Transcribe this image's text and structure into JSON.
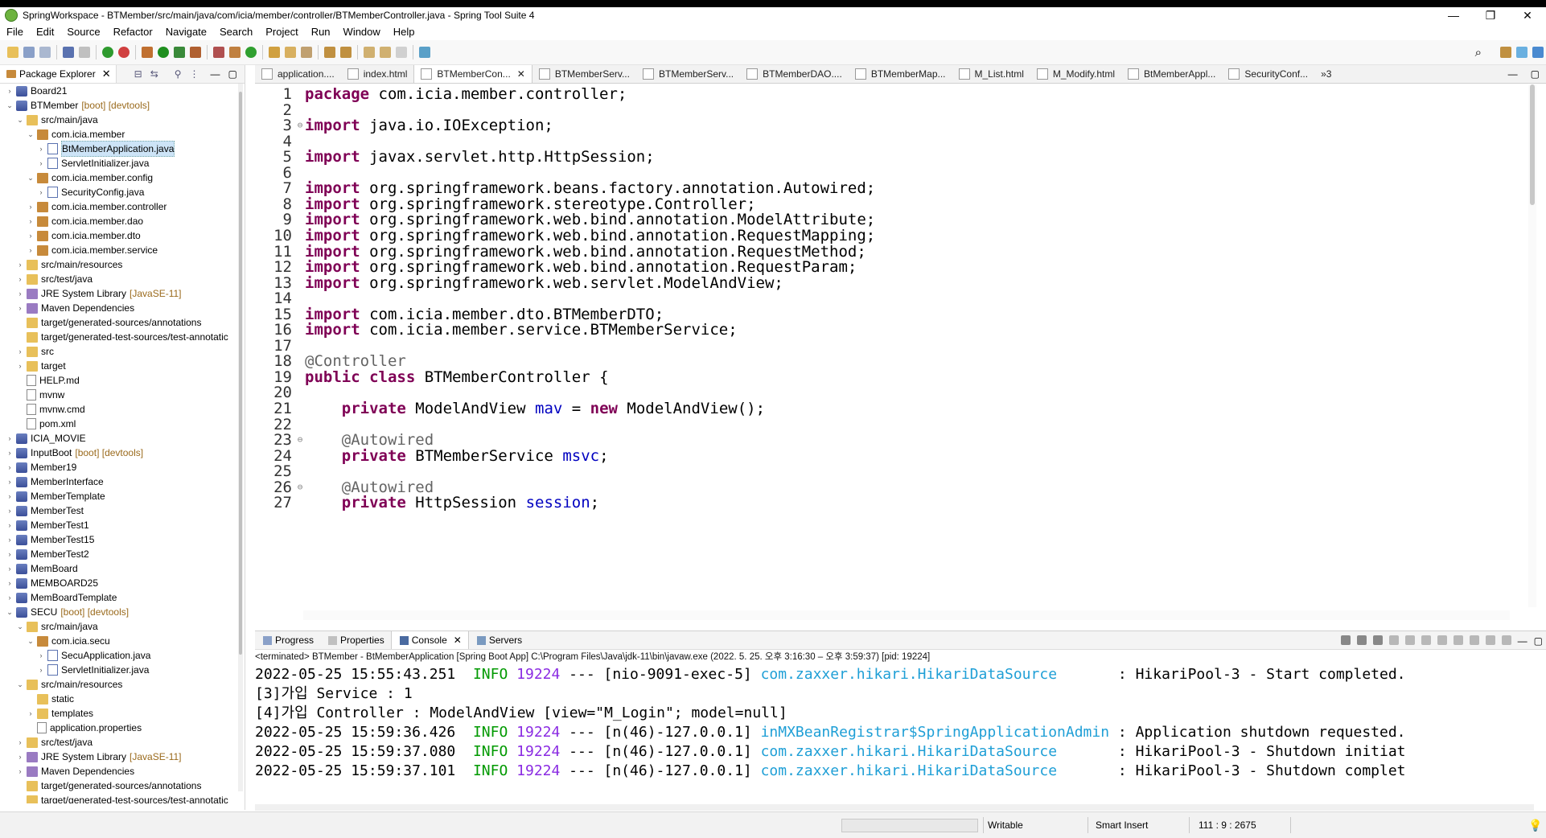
{
  "window": {
    "title": "SpringWorkspace - BTMember/src/main/java/com/icia/member/controller/BTMemberController.java - Spring Tool Suite 4",
    "minimize": "—",
    "maximize": "❐",
    "close": "✕"
  },
  "menu": [
    "File",
    "Edit",
    "Source",
    "Refactor",
    "Navigate",
    "Search",
    "Project",
    "Run",
    "Window",
    "Help"
  ],
  "package_explorer": {
    "title": "Package Explorer",
    "nodes": [
      {
        "label": "Board21",
        "deco": "",
        "icon": "project",
        "expanded": false,
        "depth": 0
      },
      {
        "label": "BTMember",
        "deco": "[boot] [devtools]",
        "icon": "project",
        "expanded": true,
        "depth": 0
      },
      {
        "label": "src/main/java",
        "deco": "",
        "icon": "folder",
        "expanded": true,
        "depth": 1
      },
      {
        "label": "com.icia.member",
        "deco": "",
        "icon": "package",
        "expanded": true,
        "depth": 2
      },
      {
        "label": "BtMemberApplication.java",
        "deco": "",
        "icon": "java",
        "expanded": false,
        "depth": 3,
        "selected": true
      },
      {
        "label": "ServletInitializer.java",
        "deco": "",
        "icon": "java",
        "expanded": false,
        "depth": 3
      },
      {
        "label": "com.icia.member.config",
        "deco": "",
        "icon": "package",
        "expanded": true,
        "depth": 2
      },
      {
        "label": "SecurityConfig.java",
        "deco": "",
        "icon": "java",
        "expanded": false,
        "depth": 3
      },
      {
        "label": "com.icia.member.controller",
        "deco": "",
        "icon": "package",
        "expanded": false,
        "depth": 2
      },
      {
        "label": "com.icia.member.dao",
        "deco": "",
        "icon": "package",
        "expanded": false,
        "depth": 2
      },
      {
        "label": "com.icia.member.dto",
        "deco": "",
        "icon": "package",
        "expanded": false,
        "depth": 2
      },
      {
        "label": "com.icia.member.service",
        "deco": "",
        "icon": "package",
        "expanded": false,
        "depth": 2
      },
      {
        "label": "src/main/resources",
        "deco": "",
        "icon": "folder",
        "expanded": false,
        "depth": 1
      },
      {
        "label": "src/test/java",
        "deco": "",
        "icon": "folder",
        "expanded": false,
        "depth": 1
      },
      {
        "label": "JRE System Library",
        "deco": "[JavaSE-11]",
        "icon": "library",
        "expanded": false,
        "depth": 1
      },
      {
        "label": "Maven Dependencies",
        "deco": "",
        "icon": "library",
        "expanded": false,
        "depth": 1
      },
      {
        "label": "target/generated-sources/annotations",
        "deco": "",
        "icon": "folder",
        "expanded": null,
        "depth": 1
      },
      {
        "label": "target/generated-test-sources/test-annotatic",
        "deco": "",
        "icon": "folder",
        "expanded": null,
        "depth": 1
      },
      {
        "label": "src",
        "deco": "",
        "icon": "folder",
        "expanded": false,
        "depth": 1
      },
      {
        "label": "target",
        "deco": "",
        "icon": "folder",
        "expanded": false,
        "depth": 1
      },
      {
        "label": "HELP.md",
        "deco": "",
        "icon": "file",
        "expanded": null,
        "depth": 1
      },
      {
        "label": "mvnw",
        "deco": "",
        "icon": "file",
        "expanded": null,
        "depth": 1
      },
      {
        "label": "mvnw.cmd",
        "deco": "",
        "icon": "file",
        "expanded": null,
        "depth": 1
      },
      {
        "label": "pom.xml",
        "deco": "",
        "icon": "file",
        "expanded": null,
        "depth": 1
      },
      {
        "label": "ICIA_MOVIE",
        "deco": "",
        "icon": "project",
        "expanded": false,
        "depth": 0
      },
      {
        "label": "InputBoot",
        "deco": "[boot] [devtools]",
        "icon": "project",
        "expanded": false,
        "depth": 0
      },
      {
        "label": "Member19",
        "deco": "",
        "icon": "project",
        "expanded": false,
        "depth": 0
      },
      {
        "label": "MemberInterface",
        "deco": "",
        "icon": "project",
        "expanded": false,
        "depth": 0
      },
      {
        "label": "MemberTemplate",
        "deco": "",
        "icon": "project",
        "expanded": false,
        "depth": 0
      },
      {
        "label": "MemberTest",
        "deco": "",
        "icon": "project",
        "expanded": false,
        "depth": 0
      },
      {
        "label": "MemberTest1",
        "deco": "",
        "icon": "project",
        "expanded": false,
        "depth": 0
      },
      {
        "label": "MemberTest15",
        "deco": "",
        "icon": "project",
        "expanded": false,
        "depth": 0
      },
      {
        "label": "MemberTest2",
        "deco": "",
        "icon": "project",
        "expanded": false,
        "depth": 0
      },
      {
        "label": "MemBoard",
        "deco": "",
        "icon": "project",
        "expanded": false,
        "depth": 0
      },
      {
        "label": "MEMBOARD25",
        "deco": "",
        "icon": "project",
        "expanded": false,
        "depth": 0
      },
      {
        "label": "MemBoardTemplate",
        "deco": "",
        "icon": "project",
        "expanded": false,
        "depth": 0
      },
      {
        "label": "SECU",
        "deco": "[boot] [devtools]",
        "icon": "project",
        "expanded": true,
        "depth": 0
      },
      {
        "label": "src/main/java",
        "deco": "",
        "icon": "folder",
        "expanded": true,
        "depth": 1
      },
      {
        "label": "com.icia.secu",
        "deco": "",
        "icon": "package",
        "expanded": true,
        "depth": 2
      },
      {
        "label": "SecuApplication.java",
        "deco": "",
        "icon": "java",
        "expanded": false,
        "depth": 3
      },
      {
        "label": "ServletInitializer.java",
        "deco": "",
        "icon": "java",
        "expanded": false,
        "depth": 3
      },
      {
        "label": "src/main/resources",
        "deco": "",
        "icon": "folder",
        "expanded": true,
        "depth": 1
      },
      {
        "label": "static",
        "deco": "",
        "icon": "folder",
        "expanded": null,
        "depth": 2
      },
      {
        "label": "templates",
        "deco": "",
        "icon": "folder",
        "expanded": false,
        "depth": 2
      },
      {
        "label": "application.properties",
        "deco": "",
        "icon": "file",
        "expanded": null,
        "depth": 2
      },
      {
        "label": "src/test/java",
        "deco": "",
        "icon": "folder",
        "expanded": false,
        "depth": 1
      },
      {
        "label": "JRE System Library",
        "deco": "[JavaSE-11]",
        "icon": "library",
        "expanded": false,
        "depth": 1
      },
      {
        "label": "Maven Dependencies",
        "deco": "",
        "icon": "library",
        "expanded": false,
        "depth": 1
      },
      {
        "label": "target/generated-sources/annotations",
        "deco": "",
        "icon": "folder",
        "expanded": null,
        "depth": 1
      },
      {
        "label": "target/generated-test-sources/test-annotatic",
        "deco": "",
        "icon": "folder",
        "expanded": null,
        "depth": 1
      }
    ]
  },
  "editor": {
    "tabs": [
      {
        "label": "application....",
        "active": false,
        "closable": false
      },
      {
        "label": "index.html",
        "active": false,
        "closable": false
      },
      {
        "label": "BTMemberCon...",
        "active": true,
        "closable": true
      },
      {
        "label": "BTMemberServ...",
        "active": false,
        "closable": false
      },
      {
        "label": "BTMemberServ...",
        "active": false,
        "closable": false
      },
      {
        "label": "BTMemberDAO....",
        "active": false,
        "closable": false
      },
      {
        "label": "BTMemberMap...",
        "active": false,
        "closable": false
      },
      {
        "label": "M_List.html",
        "active": false,
        "closable": false
      },
      {
        "label": "M_Modify.html",
        "active": false,
        "closable": false
      },
      {
        "label": "BtMemberAppl...",
        "active": false,
        "closable": false
      },
      {
        "label": "SecurityConf...",
        "active": false,
        "closable": false
      }
    ],
    "overflow_label": "»3",
    "lines": [
      {
        "n": "1",
        "fold": "",
        "tokens": [
          {
            "t": "package",
            "c": "kw"
          },
          {
            "t": " com.icia.member.controller;",
            "c": ""
          }
        ]
      },
      {
        "n": "2",
        "fold": "",
        "tokens": []
      },
      {
        "n": "3",
        "fold": "⊖",
        "tokens": [
          {
            "t": "import",
            "c": "kw"
          },
          {
            "t": " java.io.IOException;",
            "c": ""
          }
        ]
      },
      {
        "n": "4",
        "fold": "",
        "tokens": []
      },
      {
        "n": "5",
        "fold": "",
        "tokens": [
          {
            "t": "import",
            "c": "kw"
          },
          {
            "t": " javax.servlet.http.HttpSession;",
            "c": ""
          }
        ]
      },
      {
        "n": "6",
        "fold": "",
        "tokens": []
      },
      {
        "n": "7",
        "fold": "",
        "tokens": [
          {
            "t": "import",
            "c": "kw"
          },
          {
            "t": " org.springframework.beans.factory.annotation.Autowired;",
            "c": ""
          }
        ]
      },
      {
        "n": "8",
        "fold": "",
        "tokens": [
          {
            "t": "import",
            "c": "kw"
          },
          {
            "t": " org.springframework.stereotype.Controller;",
            "c": ""
          }
        ]
      },
      {
        "n": "9",
        "fold": "",
        "tokens": [
          {
            "t": "import",
            "c": "kw"
          },
          {
            "t": " org.springframework.web.bind.annotation.ModelAttribute;",
            "c": ""
          }
        ]
      },
      {
        "n": "10",
        "fold": "",
        "tokens": [
          {
            "t": "import",
            "c": "kw"
          },
          {
            "t": " org.springframework.web.bind.annotation.RequestMapping;",
            "c": ""
          }
        ]
      },
      {
        "n": "11",
        "fold": "",
        "tokens": [
          {
            "t": "import",
            "c": "kw"
          },
          {
            "t": " org.springframework.web.bind.annotation.RequestMethod;",
            "c": ""
          }
        ]
      },
      {
        "n": "12",
        "fold": "",
        "tokens": [
          {
            "t": "import",
            "c": "kw"
          },
          {
            "t": " org.springframework.web.bind.annotation.RequestParam;",
            "c": ""
          }
        ]
      },
      {
        "n": "13",
        "fold": "",
        "tokens": [
          {
            "t": "import",
            "c": "kw"
          },
          {
            "t": " org.springframework.web.servlet.ModelAndView;",
            "c": ""
          }
        ]
      },
      {
        "n": "14",
        "fold": "",
        "tokens": []
      },
      {
        "n": "15",
        "fold": "",
        "tokens": [
          {
            "t": "import",
            "c": "kw"
          },
          {
            "t": " com.icia.member.dto.BTMemberDTO;",
            "c": ""
          }
        ]
      },
      {
        "n": "16",
        "fold": "",
        "tokens": [
          {
            "t": "import",
            "c": "kw"
          },
          {
            "t": " com.icia.member.service.BTMemberService;",
            "c": ""
          }
        ]
      },
      {
        "n": "17",
        "fold": "",
        "tokens": []
      },
      {
        "n": "18",
        "fold": "",
        "tokens": [
          {
            "t": "@Controller",
            "c": "anno"
          }
        ]
      },
      {
        "n": "19",
        "fold": "",
        "tokens": [
          {
            "t": "public",
            "c": "kw"
          },
          {
            "t": " ",
            "c": ""
          },
          {
            "t": "class",
            "c": "kw"
          },
          {
            "t": " BTMemberController {",
            "c": ""
          }
        ]
      },
      {
        "n": "20",
        "fold": "",
        "tokens": []
      },
      {
        "n": "21",
        "fold": "",
        "tokens": [
          {
            "t": "    ",
            "c": ""
          },
          {
            "t": "private",
            "c": "kw"
          },
          {
            "t": " ModelAndView ",
            "c": ""
          },
          {
            "t": "mav",
            "c": "field"
          },
          {
            "t": " = ",
            "c": ""
          },
          {
            "t": "new",
            "c": "kw"
          },
          {
            "t": " ModelAndView();",
            "c": ""
          }
        ]
      },
      {
        "n": "22",
        "fold": "",
        "tokens": []
      },
      {
        "n": "23",
        "fold": "⊖",
        "tokens": [
          {
            "t": "    ",
            "c": ""
          },
          {
            "t": "@Autowired",
            "c": "anno"
          }
        ]
      },
      {
        "n": "24",
        "fold": "",
        "tokens": [
          {
            "t": "    ",
            "c": ""
          },
          {
            "t": "private",
            "c": "kw"
          },
          {
            "t": " BTMemberService ",
            "c": ""
          },
          {
            "t": "msvc",
            "c": "field"
          },
          {
            "t": ";",
            "c": ""
          }
        ]
      },
      {
        "n": "25",
        "fold": "",
        "tokens": []
      },
      {
        "n": "26",
        "fold": "⊖",
        "tokens": [
          {
            "t": "    ",
            "c": ""
          },
          {
            "t": "@Autowired",
            "c": "anno"
          }
        ]
      },
      {
        "n": "27",
        "fold": "",
        "tokens": [
          {
            "t": "    ",
            "c": ""
          },
          {
            "t": "private",
            "c": "kw"
          },
          {
            "t": " HttpSession ",
            "c": ""
          },
          {
            "t": "session",
            "c": "field"
          },
          {
            "t": ";",
            "c": ""
          }
        ]
      }
    ]
  },
  "bottom_panel": {
    "tabs": [
      {
        "label": "Progress",
        "active": false
      },
      {
        "label": "Properties",
        "active": false
      },
      {
        "label": "Console",
        "active": true
      },
      {
        "label": "Servers",
        "active": false
      }
    ],
    "terminated_line": "<terminated> BTMember - BtMemberApplication [Spring Boot App] C:\\Program Files\\Java\\jdk-11\\bin\\javaw.exe  (2022. 5. 25. 오후 3:16:30 – 오후 3:59:37) [pid: 19224]",
    "console_lines": [
      {
        "segs": [
          {
            "t": "2022-05-25 15:55:43.251  ",
            "c": ""
          },
          {
            "t": "INFO",
            "c": "info"
          },
          {
            "t": " ",
            "c": ""
          },
          {
            "t": "19224",
            "c": "pid"
          },
          {
            "t": " --- [nio-9091-exec-5] ",
            "c": ""
          },
          {
            "t": "com.zaxxer.hikari.HikariDataSource      ",
            "c": "cls"
          },
          {
            "t": " : HikariPool-3 - Start completed.",
            "c": ""
          }
        ]
      },
      {
        "segs": [
          {
            "t": "[3]가입 Service : 1",
            "c": ""
          }
        ]
      },
      {
        "segs": [
          {
            "t": "[4]가입 Controller : ModelAndView [view=\"M_Login\"; model=null]",
            "c": ""
          }
        ]
      },
      {
        "segs": [
          {
            "t": "2022-05-25 15:59:36.426  ",
            "c": ""
          },
          {
            "t": "INFO",
            "c": "info"
          },
          {
            "t": " ",
            "c": ""
          },
          {
            "t": "19224",
            "c": "pid"
          },
          {
            "t": " --- [n(46)-127.0.0.1] ",
            "c": ""
          },
          {
            "t": "inMXBeanRegistrar$SpringApplicationAdmin",
            "c": "cls"
          },
          {
            "t": " : Application shutdown requested.",
            "c": ""
          }
        ]
      },
      {
        "segs": [
          {
            "t": "2022-05-25 15:59:37.080  ",
            "c": ""
          },
          {
            "t": "INFO",
            "c": "info"
          },
          {
            "t": " ",
            "c": ""
          },
          {
            "t": "19224",
            "c": "pid"
          },
          {
            "t": " --- [n(46)-127.0.0.1] ",
            "c": ""
          },
          {
            "t": "com.zaxxer.hikari.HikariDataSource      ",
            "c": "cls"
          },
          {
            "t": " : HikariPool-3 - Shutdown initiat",
            "c": ""
          }
        ]
      },
      {
        "segs": [
          {
            "t": "2022-05-25 15:59:37.101  ",
            "c": ""
          },
          {
            "t": "INFO",
            "c": "info"
          },
          {
            "t": " ",
            "c": ""
          },
          {
            "t": "19224",
            "c": "pid"
          },
          {
            "t": " --- [n(46)-127.0.0.1] ",
            "c": ""
          },
          {
            "t": "com.zaxxer.hikari.HikariDataSource      ",
            "c": "cls"
          },
          {
            "t": " : HikariPool-3 - Shutdown complet",
            "c": ""
          }
        ]
      }
    ]
  },
  "status_bar": {
    "writable": "Writable",
    "insert_mode": "Smart Insert",
    "position": "111 : 9 : 2675"
  },
  "colors": {
    "keyword": "#7f0055",
    "field": "#0000c0",
    "annotation": "#646464",
    "console_info": "#009900",
    "console_pid": "#8a2be2",
    "console_class": "#1f9fd6",
    "tree_decoration": "#9a6a1c"
  }
}
